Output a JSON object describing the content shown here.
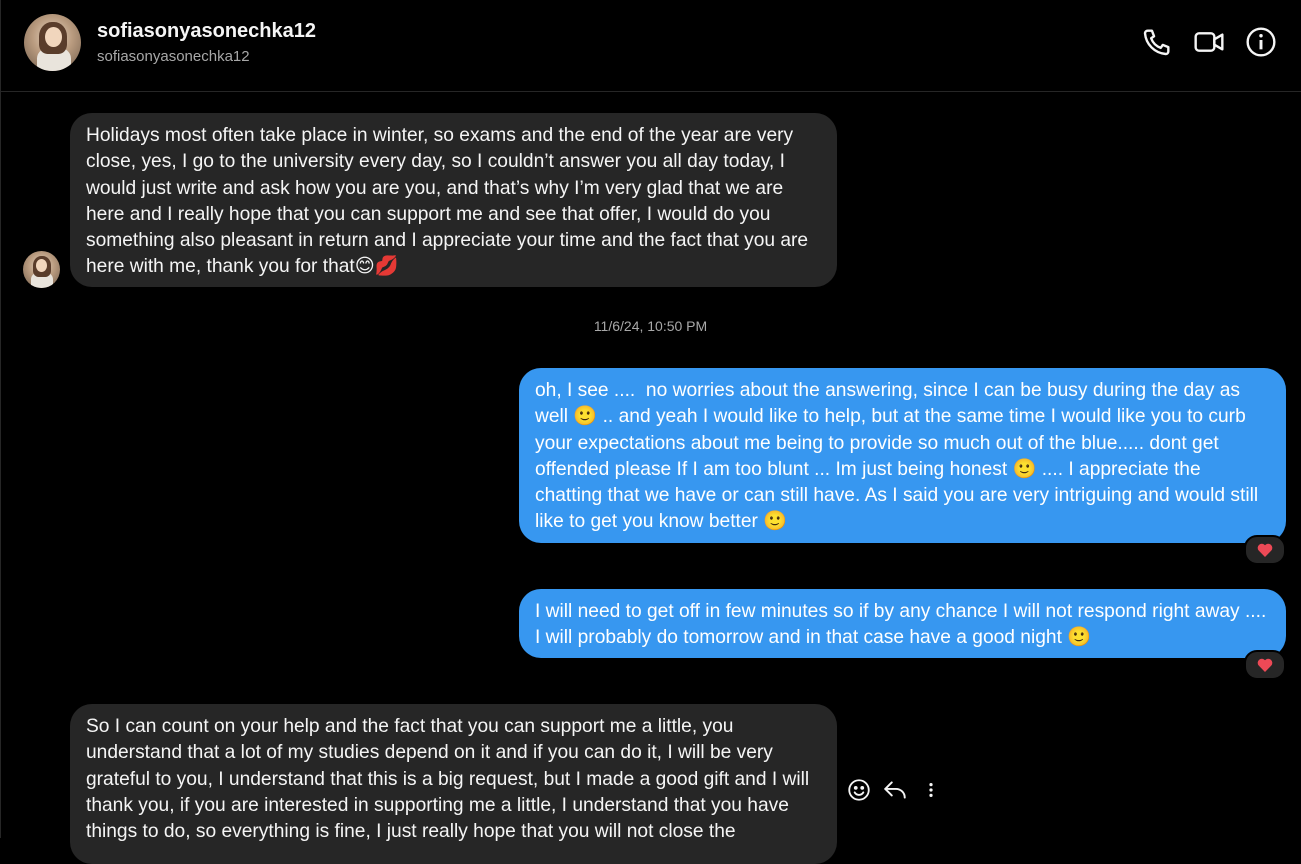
{
  "header": {
    "display_name": "sofiasonyasonechka12",
    "username": "sofiasonyasonechka12",
    "icons": [
      "phone-icon",
      "video-call-icon",
      "info-icon"
    ]
  },
  "messages": [
    {
      "direction": "incoming",
      "text": "Holidays most often take place in winter, so exams and the end of the year are very close, yes, I go to the university every day, so I couldn’t answer you all day today, I would just write and ask how you are you, and that’s why I’m very glad that we are here and I really hope that you can support me and see that offer, I would do you something also pleasant in return and I appreciate your time and the fact that you are here with me, thank you for that😊💋"
    },
    {
      "direction": "outgoing",
      "text": "oh, I see ....  no worries about the answering, since I can be busy during the day as well 🙂 .. and yeah I would like to help, but at the same time I would like you to curb your expectations about me being to provide so much out of the blue..... dont get offended please If I am too blunt ... Im just being honest 🙂 .... I appreciate the chatting that we have or can still have. As I said you are very intriguing and would still like to get you know better 🙂",
      "reaction": "❤️"
    },
    {
      "direction": "outgoing",
      "text": "I will need to get off in few minutes so if by any chance I will not respond right away .... I will probably do tomorrow and in that case have a good night 🙂",
      "reaction": "❤️"
    },
    {
      "direction": "incoming",
      "text": "So I can count on your help and the fact that you can support me a little, you understand that a lot of my studies depend on it and if you can do it, I will be very grateful to you, I understand that this is a big request, but I made a good gift and I will thank you, if you are interested in supporting me a little, I understand that you have things to do, so everything is fine, I just really hope that you will not close the"
    }
  ],
  "timestamp": "11/6/24, 10:50 PM",
  "message_actions": [
    "react-icon",
    "reply-icon",
    "more-options-icon"
  ],
  "colors": {
    "background": "#000000",
    "incoming_bubble": "#262626",
    "outgoing_bubble": "#3797f0",
    "secondary_text": "#a8a8a8"
  }
}
